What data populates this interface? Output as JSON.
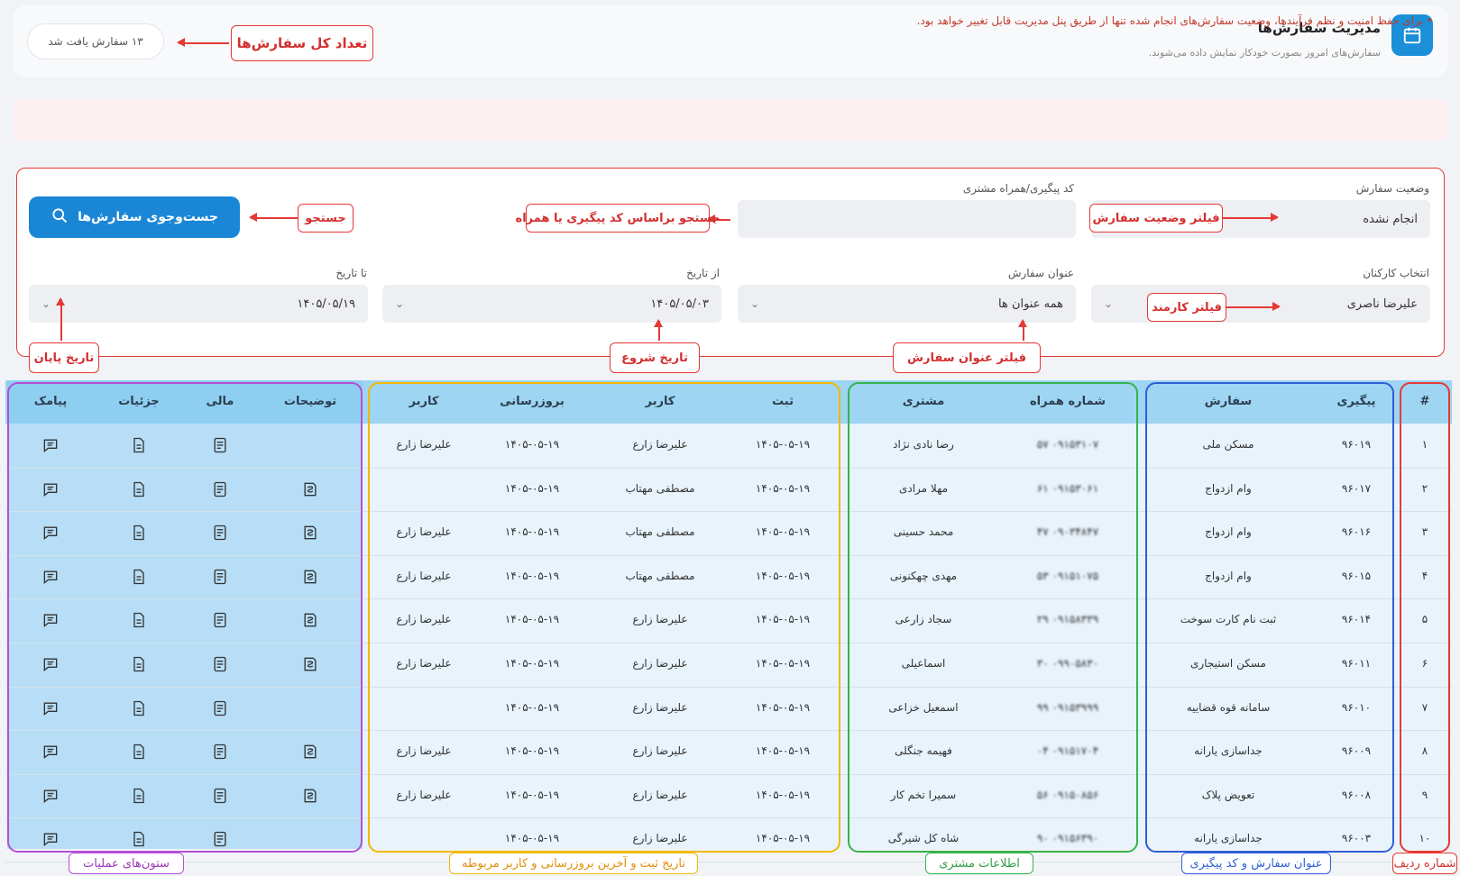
{
  "header": {
    "title": "مدیریت سفارش‌ها",
    "subtitle": "سفارش‌های امروز بصورت خودکار نمایش داده می‌شوند.",
    "count_text": "۱۳ سفارش یافت شد"
  },
  "alert": {
    "text": "• برای حفظ امنیت و نظم فرآیندها، وضعیت سفارش‌های انجام شده تنها از طریق پنل مدیریت قابل تغییر خواهد بود."
  },
  "filters": {
    "status_label": "وضعیت سفارش",
    "status_value": "انجام نشده",
    "tracking_label": "کد پیگیری/همراه مشتری",
    "tracking_value": "",
    "search_button": "جست‌وجوی سفارش‌ها",
    "employee_label": "انتخاب کارکنان",
    "employee_value": "علیرضا ناصری",
    "title_label": "عنوان سفارش",
    "title_value": "همه عنوان ها",
    "from_label": "از تاریخ",
    "from_value": "۱۴۰۵/۰۵/۰۳",
    "to_label": "تا تاریخ",
    "to_value": "۱۴۰۵/۰۵/۱۹"
  },
  "annotations": {
    "total_orders": "تعداد کل سفارش‌ها",
    "status_filter": "فیلتر وضعیت سفارش",
    "tracking_search": "جستجو براساس کد پیگیری یا همراه",
    "search": "جستجو",
    "employee_filter": "فیلتر کارمند",
    "title_filter": "فیلتر عنوان سفارش",
    "start_date": "تاریخ شروع",
    "end_date": "تاریخ پایان",
    "row_number": "شماره ردیف",
    "order_title_tracking": "عنوان سفارش و کد پیگیری",
    "customer_info": "اطلاعات مشتری",
    "dates_users": "تاریخ ثبت و آخرین بروزرسانی و کاربر مربوطه",
    "ops_columns": "ستون‌های عملیات"
  },
  "table": {
    "headers": {
      "row": "#",
      "tracking": "پیگیری",
      "order": "سفارش",
      "phone": "شماره همراه",
      "customer": "مشتری",
      "registered": "ثبت",
      "user1": "کاربر",
      "updated": "بروزرسانی",
      "user2": "کاربر",
      "notes": "توضیحات",
      "finance": "مالی",
      "details": "جزئیات",
      "sms": "پیامک"
    },
    "rows": [
      {
        "row": "۱",
        "tracking": "۹۶۰۱۹",
        "order": "مسکن ملی",
        "phone": "۰۹۱۵۳۱۰۷ ۵۷",
        "customer": "رضا نادی نژاد",
        "registered": "۱۴۰۵-۰۵-۱۹",
        "user1": "علیرضا زارع",
        "updated": "۱۴۰۵-۰۵-۱۹",
        "user2": "علیرضا زارع",
        "has_notes": false
      },
      {
        "row": "۲",
        "tracking": "۹۶۰۱۷",
        "order": "وام ازدواج",
        "phone": "۰۹۱۵۳۰۶۱ ۶۱",
        "customer": "مهلا مرادی",
        "registered": "۱۴۰۵-۰۵-۱۹",
        "user1": "مصطفی مهتاب",
        "updated": "۱۴۰۵-۰۵-۱۹",
        "user2": "",
        "has_notes": true
      },
      {
        "row": "۳",
        "tracking": "۹۶۰۱۶",
        "order": "وام ازدواج",
        "phone": "۰۹۰۳۴۸۴۷ ۴۷",
        "customer": "محمد حسینی",
        "registered": "۱۴۰۵-۰۵-۱۹",
        "user1": "مصطفی مهتاب",
        "updated": "۱۴۰۵-۰۵-۱۹",
        "user2": "علیرضا زارع",
        "has_notes": true
      },
      {
        "row": "۴",
        "tracking": "۹۶۰۱۵",
        "order": "وام ازدواج",
        "phone": "۰۹۱۵۱۰۷۵ ۵۳",
        "customer": "مهدی چهکنونی",
        "registered": "۱۴۰۵-۰۵-۱۹",
        "user1": "مصطفی مهتاب",
        "updated": "۱۴۰۵-۰۵-۱۹",
        "user2": "علیرضا زارع",
        "has_notes": true
      },
      {
        "row": "۵",
        "tracking": "۹۶۰۱۴",
        "order": "ثبت نام کارت سوخت",
        "phone": "۰۹۱۵۸۳۳۹ ۲۹",
        "customer": "سجاد زارعی",
        "registered": "۱۴۰۵-۰۵-۱۹",
        "user1": "علیرضا زارع",
        "updated": "۱۴۰۵-۰۵-۱۹",
        "user2": "علیرضا زارع",
        "has_notes": true
      },
      {
        "row": "۶",
        "tracking": "۹۶۰۱۱",
        "order": "مسکن استیجاری",
        "phone": "۰۹۹۰۵۸۳۰ ۳۰",
        "customer": "اسماعیلی",
        "registered": "۱۴۰۵-۰۵-۱۹",
        "user1": "علیرضا زارع",
        "updated": "۱۴۰۵-۰۵-۱۹",
        "user2": "علیرضا زارع",
        "has_notes": true
      },
      {
        "row": "۷",
        "tracking": "۹۶۰۱۰",
        "order": "سامانه قوه قضاییه",
        "phone": "۰۹۱۵۳۹۹۹ ۹۹",
        "customer": "اسمعیل خزاعی",
        "registered": "۱۴۰۵-۰۵-۱۹",
        "user1": "علیرضا زارع",
        "updated": "۱۴۰۵-۰۵-۱۹",
        "user2": "",
        "has_notes": false
      },
      {
        "row": "۸",
        "tracking": "۹۶۰۰۹",
        "order": "جداسازی یارانه",
        "phone": "۰۹۱۵۱۷۰۴ ۰۴",
        "customer": "فهیمه جنگلی",
        "registered": "۱۴۰۵-۰۵-۱۹",
        "user1": "علیرضا زارع",
        "updated": "۱۴۰۵-۰۵-۱۹",
        "user2": "علیرضا زارع",
        "has_notes": true
      },
      {
        "row": "۹",
        "tracking": "۹۶۰۰۸",
        "order": "تعویض پلاک",
        "phone": "۰۹۱۵۰۸۵۶ ۵۶",
        "customer": "سمیرا تخم کار",
        "registered": "۱۴۰۵-۰۵-۱۹",
        "user1": "علیرضا زارع",
        "updated": "۱۴۰۵-۰۵-۱۹",
        "user2": "علیرضا زارع",
        "has_notes": true
      },
      {
        "row": "۱۰",
        "tracking": "۹۶۰۰۳",
        "order": "جداسازی یارانه",
        "phone": "۰۹۱۵۶۳۹۰ ۹۰",
        "customer": "شاه کل شیرگی",
        "registered": "۱۴۰۵-۰۵-۱۹",
        "user1": "علیرضا زارع",
        "updated": "۱۴۰۵-۰۵-۱۹",
        "user2": "",
        "has_notes": false
      }
    ]
  },
  "colors": {
    "primary": "#1a86d6",
    "annotation_red": "#e53935",
    "group_blue": "#2f5fd8",
    "group_green": "#37b24d",
    "group_yellow": "#f2b705",
    "group_purple": "#b44fd6"
  }
}
